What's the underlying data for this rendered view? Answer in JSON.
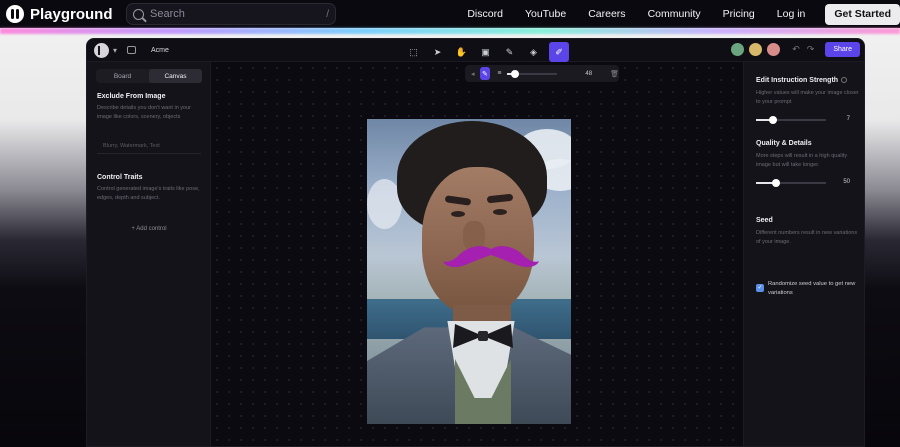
{
  "nav": {
    "brand": "Playground",
    "search_placeholder": "Search",
    "search_shortcut": "/",
    "links": [
      "Discord",
      "YouTube",
      "Careers",
      "Community",
      "Pricing",
      "Log in"
    ],
    "cta": "Get Started"
  },
  "app": {
    "project_name": "Acme",
    "share_label": "Share",
    "tools": [
      "select-tool",
      "pointer-tool",
      "hand-tool",
      "image-tool",
      "pen-tool",
      "fill-tool",
      "brush-tool"
    ],
    "accent_color": "#5b44e8"
  },
  "left_panel": {
    "tabs": [
      "Board",
      "Canvas"
    ],
    "active_tab": "Canvas",
    "exclude": {
      "title": "Exclude From Image",
      "description": "Describe details you don't want in your image like colors, scenery, objects",
      "placeholder": "Blurry, Watermark, Text"
    },
    "control": {
      "title": "Control Traits",
      "description": "Control generated image's traits like pose, edges, depth and subject.",
      "add_label": "+ Add control"
    }
  },
  "brush_bar": {
    "size_value": "48",
    "size_fraction": 0.15
  },
  "right_panel": {
    "strength": {
      "title": "Edit Instruction Strength",
      "description": "Higher values will make your image closer to your prompt",
      "value": "7",
      "fraction": 0.24
    },
    "quality": {
      "title": "Quality & Details",
      "description": "More steps will result in a high quality image but will take longer.",
      "value": "50",
      "fraction": 0.28
    },
    "seed": {
      "title": "Seed",
      "description": "Different numbers result in new variations of your image.",
      "randomize_label": "Randomize seed value to get new variations",
      "randomize_checked": true
    }
  }
}
